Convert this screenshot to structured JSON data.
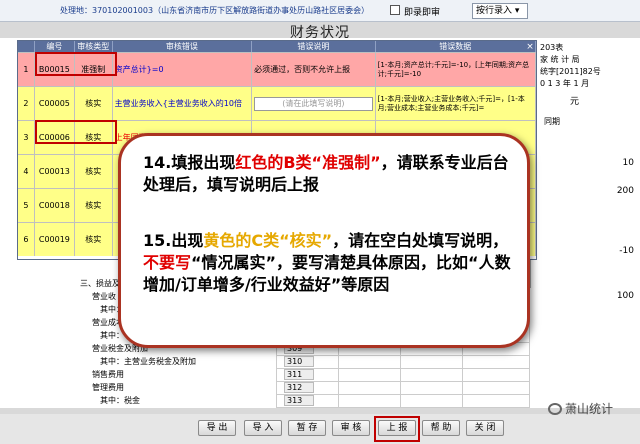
{
  "topbar": {
    "info_label": "处理地：",
    "info_value": "370102001003（山东省济南市历下区解放路街道办事处历山路社区居委会）",
    "checkbox_label": "即录即审",
    "entry_select": "按行录入"
  },
  "form_title": "财务状况",
  "right_info": {
    "line1": "203表",
    "line2": "家 统 计 局",
    "line3": "统字[2011]82号",
    "line4": "0 1 3 年 1 月",
    "unit": "元",
    "line5": "同期",
    "values": [
      "10",
      "200",
      "-10",
      "100"
    ]
  },
  "popup": {
    "columns": [
      "编号",
      "审核类型",
      "审核错误",
      "错误说明",
      "错误数据"
    ],
    "rows": [
      {
        "no": "1",
        "code": "B00015",
        "type": "准强制",
        "error": "资产总计}=0",
        "note": "必须通过，否则不允许上报",
        "data": "[1-本月;资产总计;千元]=-10，[上年同期;资产总计;千元]=-10"
      },
      {
        "no": "2",
        "code": "C00005",
        "type": "核实",
        "error": "主营业务收入{主营业务收入的10倍",
        "note": "(请在此填写说明)",
        "data": "[1-本月;营业收入;主营业务收入;千元]=，[1-本月;营业成本;主营业务成本;千元]="
      },
      {
        "no": "3",
        "code": "C00006",
        "type": "核实",
        "error": "上年同期",
        "note": "",
        "data": "[上年同期;营业收入;主营业务"
      },
      {
        "no": "4",
        "code": "C00013",
        "type": "核实",
        "error": "",
        "note": "",
        "data": ""
      },
      {
        "no": "5",
        "code": "C00018",
        "type": "核实",
        "error": "",
        "note": "",
        "data": ""
      },
      {
        "no": "6",
        "code": "C00019",
        "type": "核实",
        "error": "",
        "note": "",
        "data": ""
      }
    ]
  },
  "lower_rows": [
    {
      "label": "三、损益及分配",
      "num": ""
    },
    {
      "label": "营业收",
      "num": ""
    },
    {
      "label": "其中：",
      "num": ""
    },
    {
      "label": "营业成本",
      "num": ""
    },
    {
      "label": "其中：",
      "num": ""
    },
    {
      "label": "营业税金及附加",
      "num": "309"
    },
    {
      "label": "其中：主营业务税金及附加",
      "num": "310"
    },
    {
      "label": "销售费用",
      "num": "311"
    },
    {
      "label": "管理费用",
      "num": "312"
    },
    {
      "label": "其中：税金",
      "num": "313"
    }
  ],
  "callout": {
    "p1_a": "14.填报出现",
    "p1_red": "红色的B类“准强制”",
    "p1_b": "，请联系专业后台处理后，填写说明后上报",
    "p2_a": "15.出现",
    "p2_yel": "黄色的C类“核实”",
    "p2_b": "，请在空白处填写说明，",
    "p2_red": "不要写",
    "p2_c": "“情况属实”，要写清楚具体原因，比如“人数增加/订单增多/行业效益好”等原因"
  },
  "buttons": [
    "导 出",
    "导 入",
    "暂 存",
    "审 核",
    "上 报",
    "帮 助",
    "关 闭"
  ],
  "watermark": "萧山统计"
}
